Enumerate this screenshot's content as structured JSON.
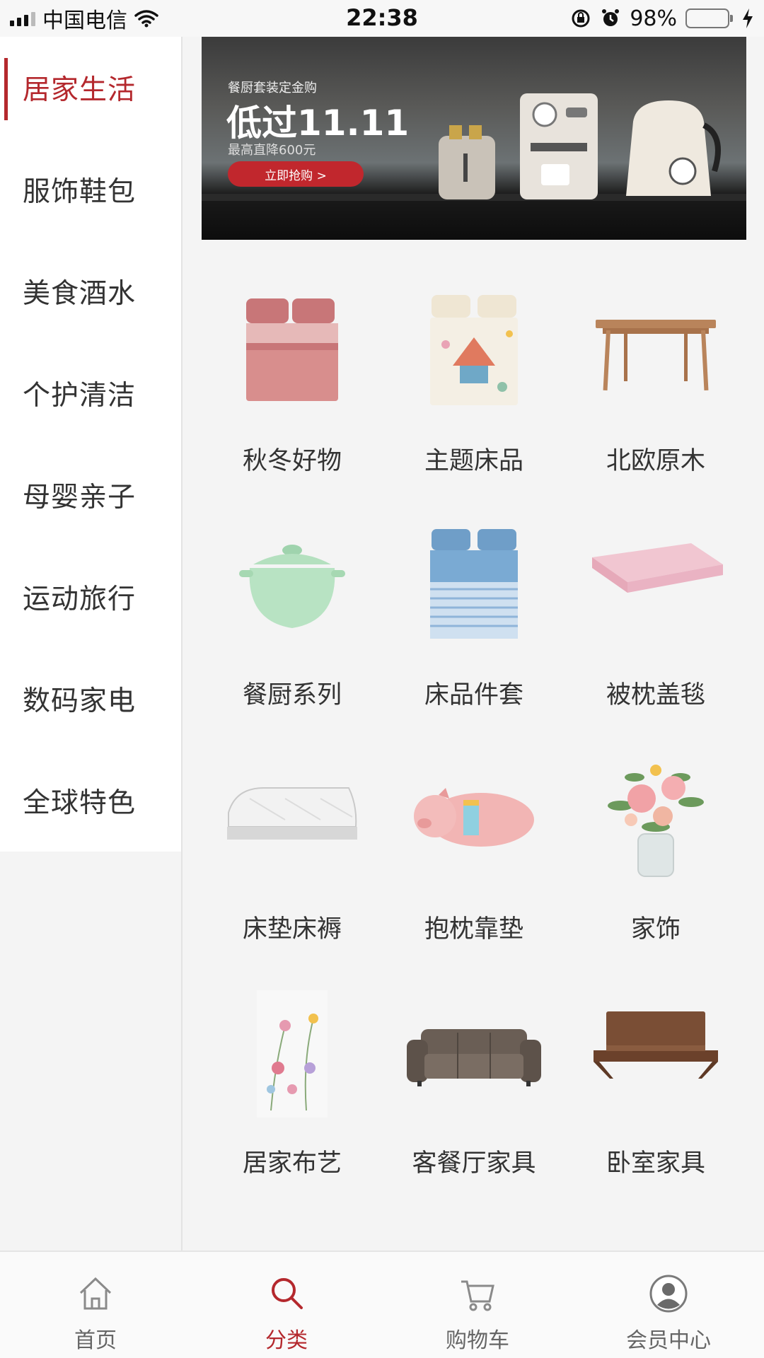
{
  "status_bar": {
    "carrier": "中国电信",
    "time": "22:38",
    "battery_text": "98%",
    "battery_level": 0.98
  },
  "sidebar": {
    "items": [
      {
        "label": "居家生活",
        "active": true
      },
      {
        "label": "服饰鞋包"
      },
      {
        "label": "美食酒水"
      },
      {
        "label": "个护清洁"
      },
      {
        "label": "母婴亲子"
      },
      {
        "label": "运动旅行"
      },
      {
        "label": "数码家电"
      },
      {
        "label": "全球特色"
      }
    ]
  },
  "banner": {
    "subtitle": "餐厨套装定金购",
    "headline": "低过11.11",
    "note": "最高直降600元",
    "cta": "立即抢购 >"
  },
  "categories": [
    {
      "label": "秋冬好物",
      "icon": "bedding-pink-icon"
    },
    {
      "label": "主题床品",
      "icon": "themed-bedding-icon"
    },
    {
      "label": "北欧原木",
      "icon": "wooden-table-icon"
    },
    {
      "label": "餐厨系列",
      "icon": "casserole-pot-icon"
    },
    {
      "label": "床品件套",
      "icon": "bedding-blue-icon"
    },
    {
      "label": "被枕盖毯",
      "icon": "folded-blanket-icon"
    },
    {
      "label": "床垫床褥",
      "icon": "mattress-icon"
    },
    {
      "label": "抱枕靠垫",
      "icon": "pig-pillow-icon"
    },
    {
      "label": "家饰",
      "icon": "flower-vase-icon"
    },
    {
      "label": "居家布艺",
      "icon": "floral-curtain-icon"
    },
    {
      "label": "客餐厅家具",
      "icon": "sofa-icon"
    },
    {
      "label": "卧室家具",
      "icon": "bed-frame-icon"
    }
  ],
  "tabbar": {
    "tabs": [
      {
        "label": "首页",
        "icon": "home-icon"
      },
      {
        "label": "分类",
        "icon": "search-icon",
        "active": true
      },
      {
        "label": "购物车",
        "icon": "cart-icon"
      },
      {
        "label": "会员中心",
        "icon": "member-icon"
      }
    ]
  },
  "colors": {
    "accent": "#b4282d",
    "cta": "#c1272d",
    "battery": "#4cd964"
  }
}
